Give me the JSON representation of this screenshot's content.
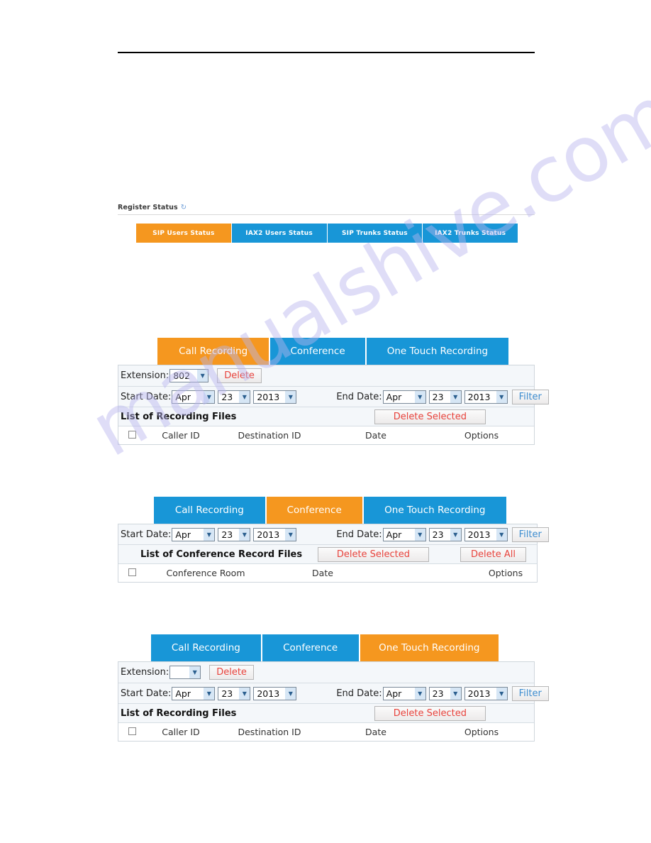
{
  "watermark": {
    "text": "manualshive.com"
  },
  "register_status": {
    "label": "Register Status",
    "refresh_icon": "refresh-icon",
    "tabs": [
      {
        "label": "SIP Users Status",
        "active": true
      },
      {
        "label": "IAX2 Users Status",
        "active": false
      },
      {
        "label": "SIP Trunks Status",
        "active": false
      },
      {
        "label": "IAX2 Trunks Status",
        "active": false
      }
    ]
  },
  "colors": {
    "accent_orange": "#f5971f",
    "accent_blue": "#1896d7",
    "danger_red": "#e8433c",
    "link_blue": "#3c8ccf",
    "panel_bg": "#f4f7fa"
  },
  "panels": [
    {
      "name": "call-recording",
      "tabs": [
        {
          "label": "Call Recording",
          "active": true
        },
        {
          "label": "Conference",
          "active": false
        },
        {
          "label": "One Touch Recording",
          "active": false
        }
      ],
      "extension": {
        "label": "Extension:",
        "value": "802",
        "delete_label": "Delete"
      },
      "start_date": {
        "label": "Start Date:",
        "month": "Apr",
        "day": "23",
        "year": "2013"
      },
      "end_date": {
        "label": "End Date:",
        "month": "Apr",
        "day": "23",
        "year": "2013"
      },
      "filter_label": "Filter",
      "list_title": "List of Recording Files",
      "delete_selected_label": "Delete Selected",
      "columns": [
        "Caller ID",
        "Destination ID",
        "Date",
        "Options"
      ]
    },
    {
      "name": "conference",
      "tabs": [
        {
          "label": "Call Recording",
          "active": false
        },
        {
          "label": "Conference",
          "active": true
        },
        {
          "label": "One Touch Recording",
          "active": false
        }
      ],
      "start_date": {
        "label": "Start Date:",
        "month": "Apr",
        "day": "23",
        "year": "2013"
      },
      "end_date": {
        "label": "End Date:",
        "month": "Apr",
        "day": "23",
        "year": "2013"
      },
      "filter_label": "Filter",
      "list_title": "List of Conference Record Files",
      "delete_selected_label": "Delete Selected",
      "delete_all_label": "Delete All",
      "columns": [
        "Conference Room",
        "Date",
        "Options"
      ]
    },
    {
      "name": "one-touch-recording",
      "tabs": [
        {
          "label": "Call Recording",
          "active": false
        },
        {
          "label": "Conference",
          "active": false
        },
        {
          "label": "One Touch Recording",
          "active": true
        }
      ],
      "extension": {
        "label": "Extension:",
        "value": "",
        "delete_label": "Delete"
      },
      "start_date": {
        "label": "Start Date:",
        "month": "Apr",
        "day": "23",
        "year": "2013"
      },
      "end_date": {
        "label": "End Date:",
        "month": "Apr",
        "day": "23",
        "year": "2013"
      },
      "filter_label": "Filter",
      "list_title": "List of Recording Files",
      "delete_selected_label": "Delete Selected",
      "columns": [
        "Caller ID",
        "Destination ID",
        "Date",
        "Options"
      ]
    }
  ]
}
